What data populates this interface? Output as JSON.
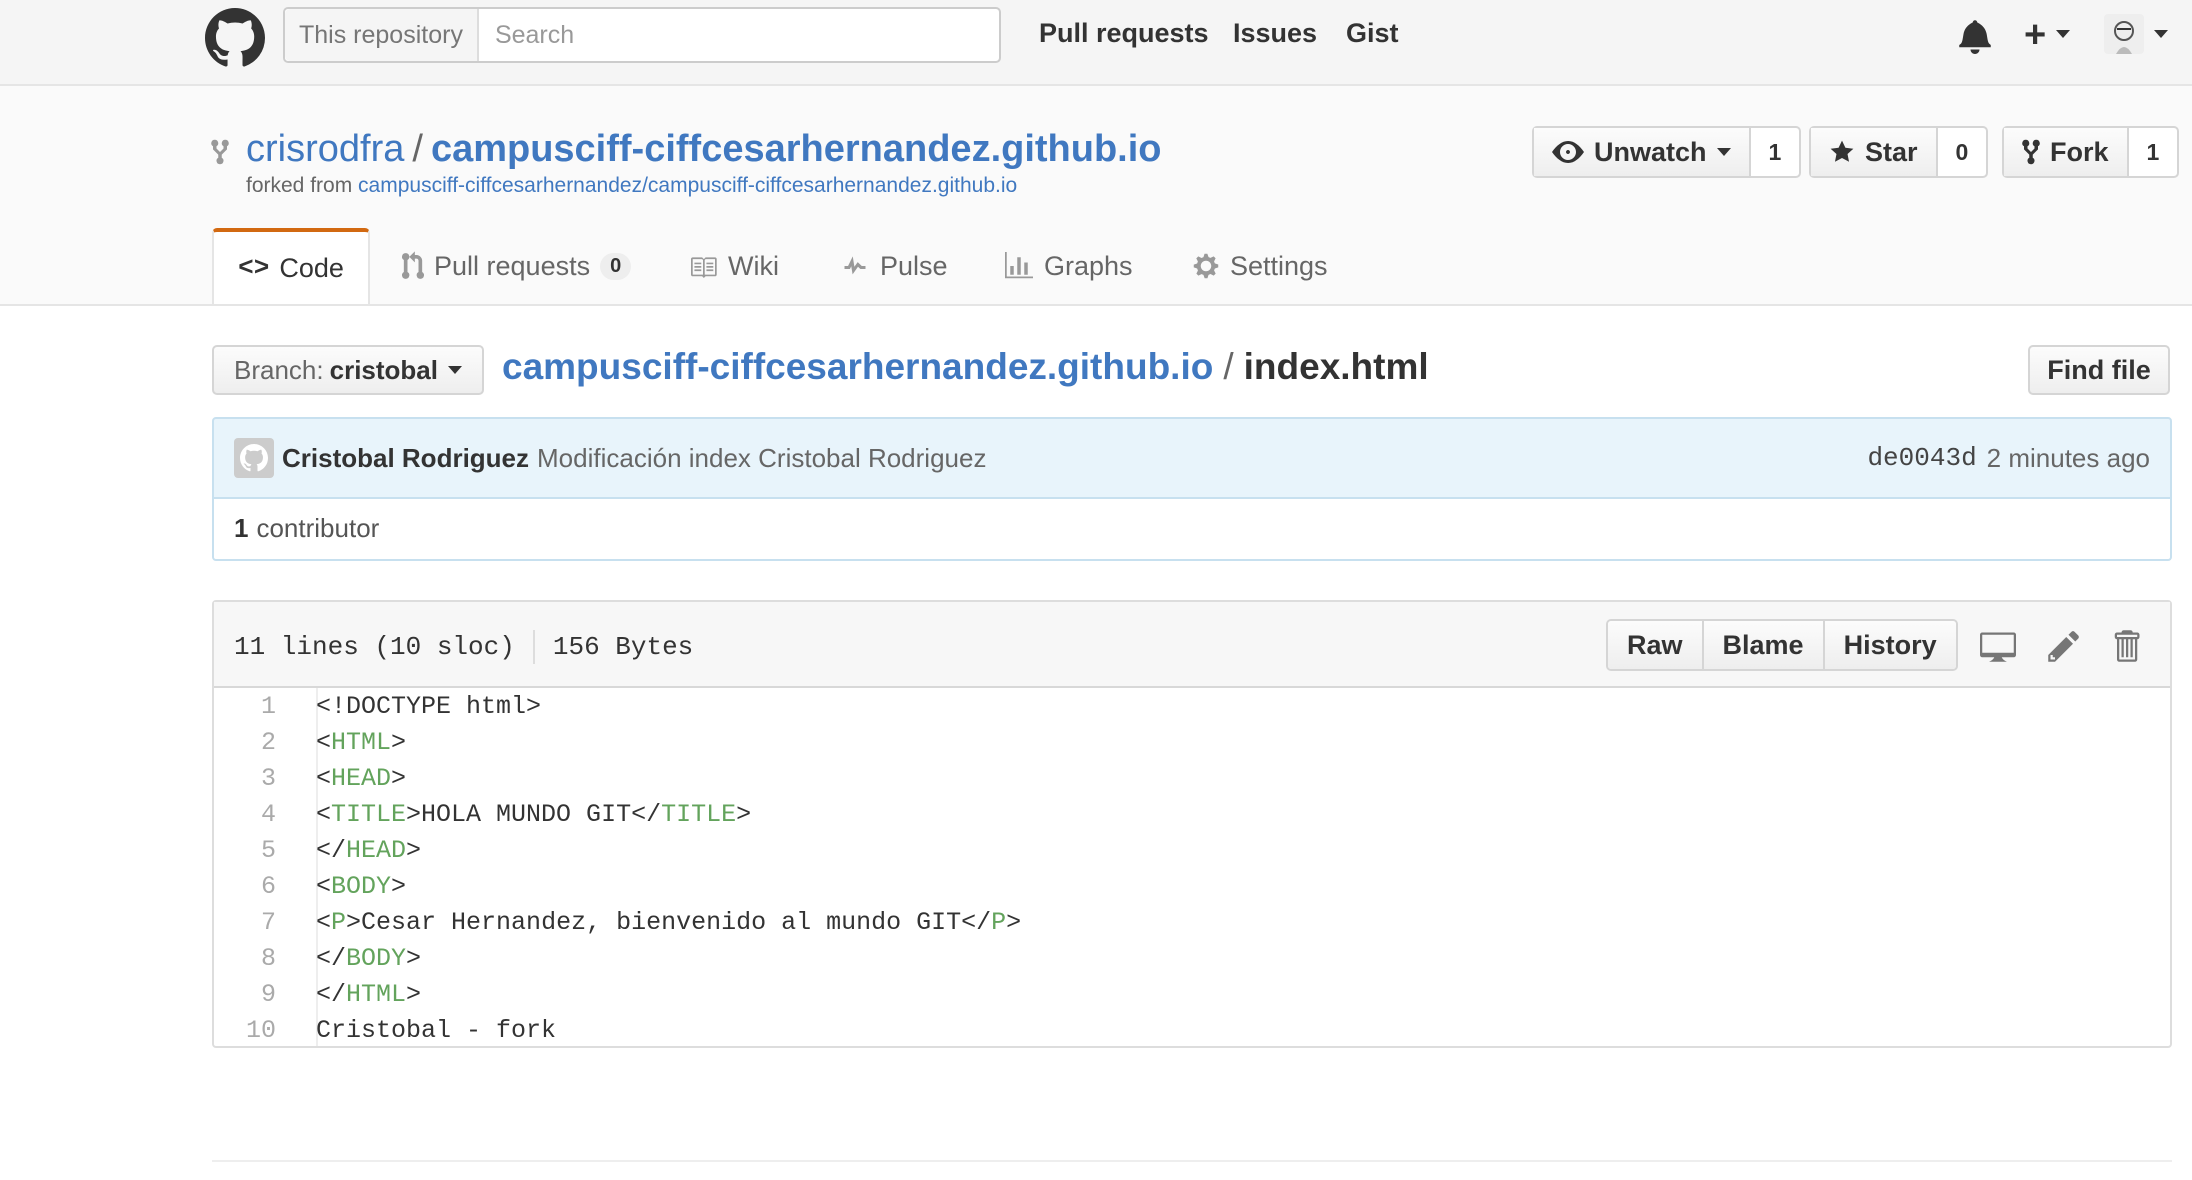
{
  "header": {
    "search_scope": "This repository",
    "search_placeholder": "Search",
    "nav": [
      "Pull requests",
      "Issues",
      "Gist"
    ]
  },
  "repo": {
    "owner": "crisrodfra",
    "separator": "/",
    "name": "campusciff-ciffcesarhernandez.github.io",
    "forked_label": "forked from",
    "forked_from": "campusciff-ciffcesarhernandez/campusciff-ciffcesarhernandez.github.io",
    "unwatch_label": "Unwatch",
    "watch_count": "1",
    "star_label": "Star",
    "star_count": "0",
    "fork_label": "Fork",
    "fork_count": "1"
  },
  "tabs": {
    "code": "Code",
    "pull_requests": "Pull requests",
    "pull_requests_count": "0",
    "wiki": "Wiki",
    "pulse": "Pulse",
    "graphs": "Graphs",
    "settings": "Settings"
  },
  "filenav": {
    "branch_label": "Branch:",
    "branch_name": "cristobal",
    "repo_link": "campusciff-ciffcesarhernandez.github.io",
    "separator": "/",
    "filename": "index.html",
    "find_file": "Find file"
  },
  "commit": {
    "author": "Cristobal Rodriguez",
    "message": "Modificación index Cristobal Rodriguez",
    "sha": "de0043d",
    "time": "2 minutes ago"
  },
  "contributors": {
    "count": "1",
    "label": "contributor"
  },
  "file": {
    "lines_info": "11 lines (10 sloc)",
    "size": "156 Bytes",
    "raw": "Raw",
    "blame": "Blame",
    "history": "History",
    "icons": [
      "desktop-icon",
      "pencil-icon",
      "trash-icon"
    ],
    "lines": [
      {
        "n": "1",
        "pre": "<!DOCTYPE html>",
        "tag": "",
        "mid": "",
        "tag2": "",
        "post": ""
      },
      {
        "n": "2",
        "pre": "<",
        "tag": "HTML",
        "mid": ">",
        "tag2": "",
        "post": ""
      },
      {
        "n": "3",
        "pre": "<",
        "tag": "HEAD",
        "mid": ">",
        "tag2": "",
        "post": ""
      },
      {
        "n": "4",
        "pre": "<",
        "tag": "TITLE",
        "mid": ">HOLA MUNDO GIT</",
        "tag2": "TITLE",
        "post": ">"
      },
      {
        "n": "5",
        "pre": "</",
        "tag": "HEAD",
        "mid": ">",
        "tag2": "",
        "post": ""
      },
      {
        "n": "6",
        "pre": "<",
        "tag": "BODY",
        "mid": ">",
        "tag2": "",
        "post": ""
      },
      {
        "n": "7",
        "pre": "<",
        "tag": "P",
        "mid": ">Cesar Hernandez, bienvenido al mundo GIT</",
        "tag2": "P",
        "post": ">"
      },
      {
        "n": "8",
        "pre": "</",
        "tag": "BODY",
        "mid": ">",
        "tag2": "",
        "post": ""
      },
      {
        "n": "9",
        "pre": "</",
        "tag": "HTML",
        "mid": ">",
        "tag2": "",
        "post": ""
      },
      {
        "n": "10",
        "pre": "Cristobal - fork",
        "tag": "",
        "mid": "",
        "tag2": "",
        "post": ""
      }
    ]
  },
  "colors": {
    "link": "#4078c0",
    "tab_accent": "#d26911",
    "commit_bg": "#e8f4fb",
    "code_tag": "#63a35c"
  }
}
